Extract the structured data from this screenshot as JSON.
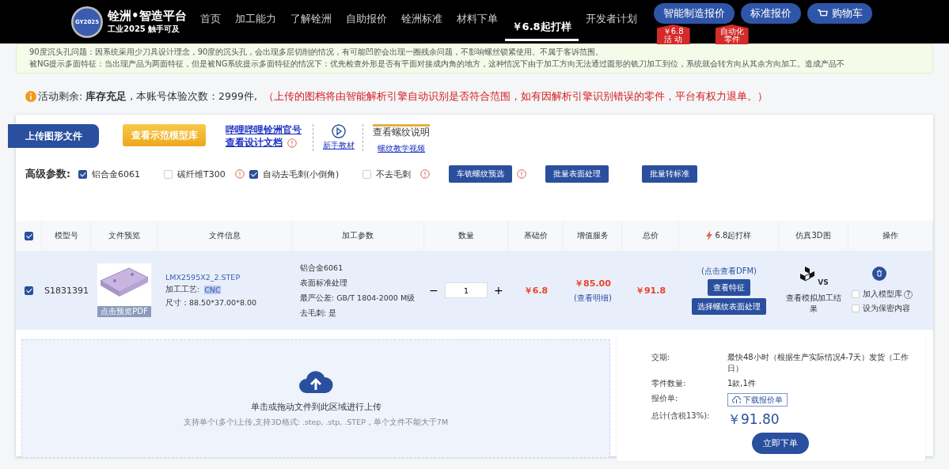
{
  "header": {
    "brand": "铨洲•智造平台",
    "slogan": "工业2025 触手可及",
    "logo_text": "GY2025",
    "nav": [
      {
        "label": "首页",
        "selected": false
      },
      {
        "label": "加工能力",
        "selected": false
      },
      {
        "label": "了解铨洲",
        "selected": false
      },
      {
        "label": "自助报价",
        "selected": false
      },
      {
        "label": "铨洲标准",
        "selected": false
      },
      {
        "label": "材料下单",
        "selected": false
      },
      {
        "label": "￥6.8起打样",
        "selected": true
      },
      {
        "label": "开发者计划",
        "selected": false
      }
    ],
    "buttons": [
      {
        "label": "智能制造报价",
        "badge": [
          "￥6.8",
          "活 动"
        ]
      },
      {
        "label": "标准报价",
        "badge": [
          "自动化",
          "零件"
        ]
      },
      {
        "label": "购物车",
        "kind": "cart"
      }
    ]
  },
  "notice": [
    "90度沉头孔问题：因系统采用少刀具设计理念，90度的沉头孔，会出现多层切削的情况，有可能凹腔会出现一圈残余问题，不影响螺丝锁紧使用。不属于客诉范围。",
    "被NG提示多面特征：当出现产品为两面特征，但是被NG系统提示多面特征的情况下：优先检查外形是否有平面对接成内角的地方，这种情况下由于加工方向无法通过圆形的铣刀加工到位，系统就会转方向从其余方向加工。造成产品不"
  ],
  "alert": {
    "text": "活动剩余: **库存充足** , 本账号体验次数：2999件,",
    "warning": "（上传的图档将由智能解析引擎自动识别是否符合范围，如有因解析引擎识别错误的零件，平台有权力退单。）"
  },
  "toolbar": {
    "upload_tab": "上传图形文件",
    "demo_button": "查看示范模型库",
    "links": [
      "哔哩哔哩铨洲官号",
      "查看设计文档"
    ],
    "tutorial": "新手教材",
    "thread_title": "查看螺纹说明",
    "thread_video": "螺纹教学视频"
  },
  "params": {
    "label": "高级参数:",
    "options": [
      {
        "label": "铝合金6061",
        "checked": true,
        "info": false
      },
      {
        "label": "碳纤维T300",
        "checked": false,
        "info": true
      },
      {
        "label": "自动去毛刺(小倒角)",
        "checked": true,
        "info": false
      },
      {
        "label": "不去毛刺",
        "checked": false,
        "info": true
      }
    ],
    "buttons": [
      {
        "label": "车铣螺纹预选",
        "info": true
      },
      {
        "label": "批量表面处理",
        "info": false
      },
      {
        "label": "批量转标准",
        "info": false
      }
    ]
  },
  "table": {
    "all_checked": true,
    "columns": [
      "模型号",
      "文件预览",
      "文件信息",
      "加工参数",
      "数量",
      "基础价",
      "增值服务",
      "总价",
      "6.8起打样",
      "仿真3D图",
      "操作"
    ],
    "rows": [
      {
        "checked": true,
        "model": "S1831391",
        "preview_label": "点击预览PDF",
        "file": "LMX2595X2_2.STEP",
        "process_label": "加工工艺:",
        "process": "CNC",
        "size": "尺寸：88.50*37.00*8.00",
        "params": [
          "铝合金6061",
          "表面标准处理",
          "最严公差: GB/T 1804-2000 M级",
          "去毛刺: 是"
        ],
        "quantity": "1",
        "minus": "−",
        "plus": "+",
        "base_price": "￥6.8",
        "service_price": "￥85.00",
        "service_detail": "(查看明细)",
        "total": "￥91.8",
        "dfm": "(点击查看DFM)",
        "feature_button": "查看特征",
        "thread_button": "选择螺纹表面处理",
        "sim_label": "查看模拟加工结果",
        "sim_icon": "VS",
        "actions": [
          {
            "label": "加入模型库",
            "checked": false,
            "help": "?"
          },
          {
            "label": "设为保密内容",
            "checked": false
          }
        ]
      }
    ]
  },
  "upload": {
    "title": "单击或拖动文件到此区域进行上传",
    "hint": "支持单个(多个)上传,支持3D格式: .step, .stp, .STEP，单个文件不能大于7M"
  },
  "summary": {
    "rows": [
      {
        "label": "交期:",
        "value": "最快48小时（根据生产实际情况4-7天）发货（工作日）"
      },
      {
        "label": "零件数量:",
        "value": "1款,1件"
      },
      {
        "label": "报价单:",
        "value": "下载报价单",
        "kind": "button"
      },
      {
        "label": "总计(含税13%):",
        "value": "￥91.80",
        "kind": "total"
      }
    ],
    "order_button": "立即下单"
  }
}
